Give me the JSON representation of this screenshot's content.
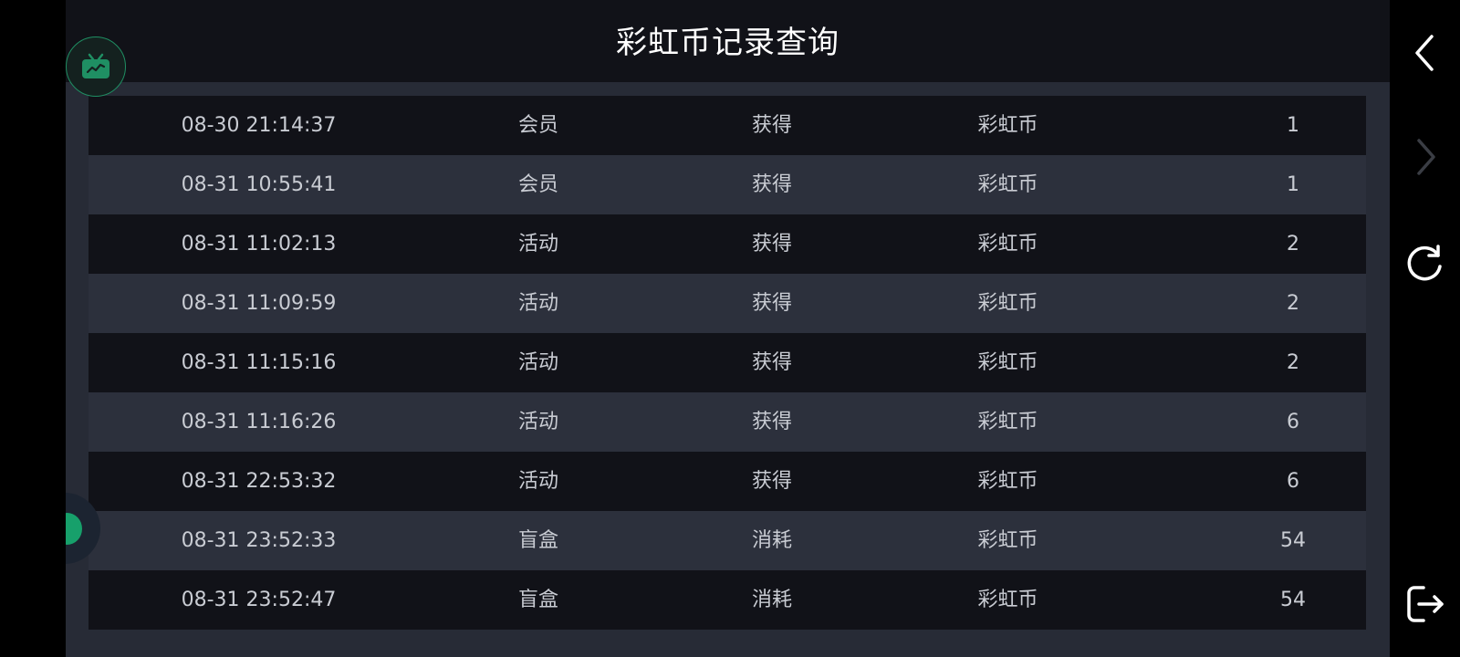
{
  "header": {
    "title": "彩虹币记录查询"
  },
  "logo": {
    "icon": "tv-icon",
    "color": "#1f8f63"
  },
  "records": [
    {
      "time": "08-30 21:14:37",
      "source": "会员",
      "type": "获得",
      "currency": "彩虹币",
      "amount": "1"
    },
    {
      "time": "08-31 10:55:41",
      "source": "会员",
      "type": "获得",
      "currency": "彩虹币",
      "amount": "1"
    },
    {
      "time": "08-31 11:02:13",
      "source": "活动",
      "type": "获得",
      "currency": "彩虹币",
      "amount": "2"
    },
    {
      "time": "08-31 11:09:59",
      "source": "活动",
      "type": "获得",
      "currency": "彩虹币",
      "amount": "2"
    },
    {
      "time": "08-31 11:15:16",
      "source": "活动",
      "type": "获得",
      "currency": "彩虹币",
      "amount": "2"
    },
    {
      "time": "08-31 11:16:26",
      "source": "活动",
      "type": "获得",
      "currency": "彩虹币",
      "amount": "6"
    },
    {
      "time": "08-31 22:53:32",
      "source": "活动",
      "type": "获得",
      "currency": "彩虹币",
      "amount": "6"
    },
    {
      "time": "08-31 23:52:33",
      "source": "盲盒",
      "type": "消耗",
      "currency": "彩虹币",
      "amount": "54"
    },
    {
      "time": "08-31 23:52:47",
      "source": "盲盒",
      "type": "消耗",
      "currency": "彩虹币",
      "amount": "54"
    }
  ],
  "nav": {
    "back_icon": "chevron-left-icon",
    "forward_icon": "chevron-right-icon",
    "refresh_icon": "refresh-icon",
    "exit_icon": "exit-icon"
  },
  "colors": {
    "background": "#272b36",
    "row_dark": "#111218",
    "row_light": "#2c303c",
    "accent": "#17a06b"
  }
}
